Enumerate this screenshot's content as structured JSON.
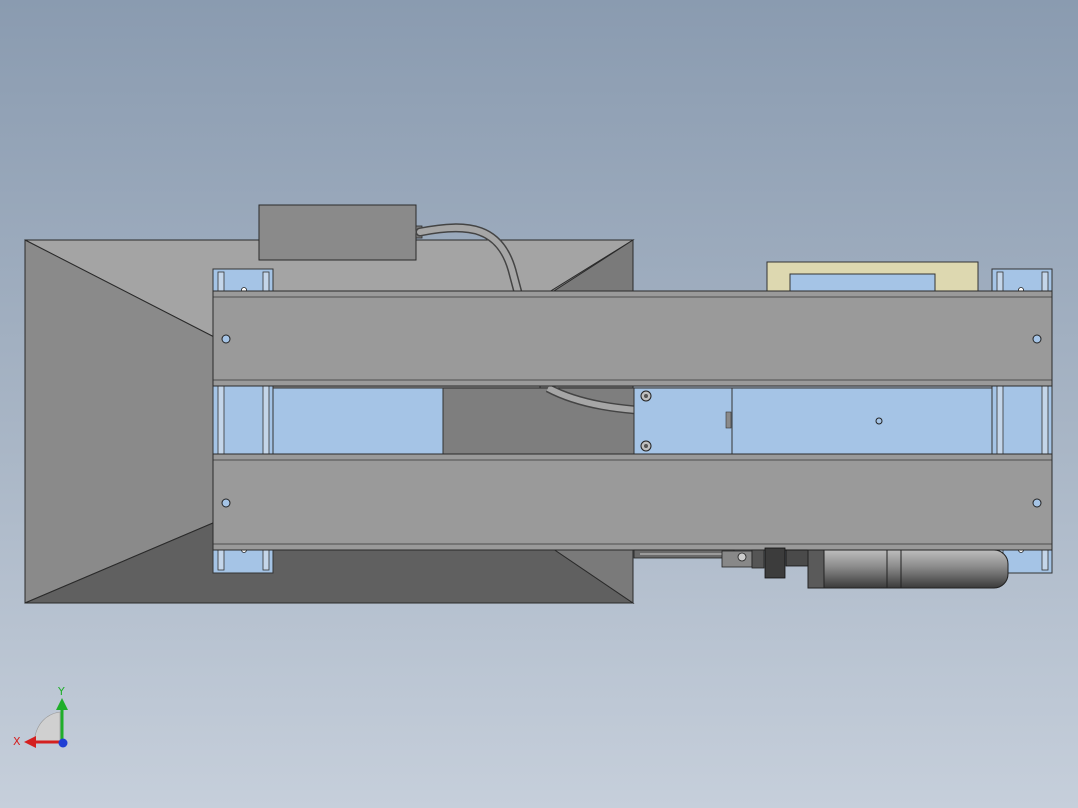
{
  "view": {
    "background_top": "#8a9bb0",
    "background_bottom": "#c6cfdb"
  },
  "triad": {
    "x_label": "X",
    "y_label": "Y",
    "x_color": "#d42020",
    "y_color": "#1fae2a",
    "z_color": "#1f3fd4"
  },
  "materials": {
    "steel": "#9a9a9a",
    "steel_dark": "#6e6e6e",
    "glass": "#a5c4e6",
    "cream": "#ddd8b0"
  }
}
